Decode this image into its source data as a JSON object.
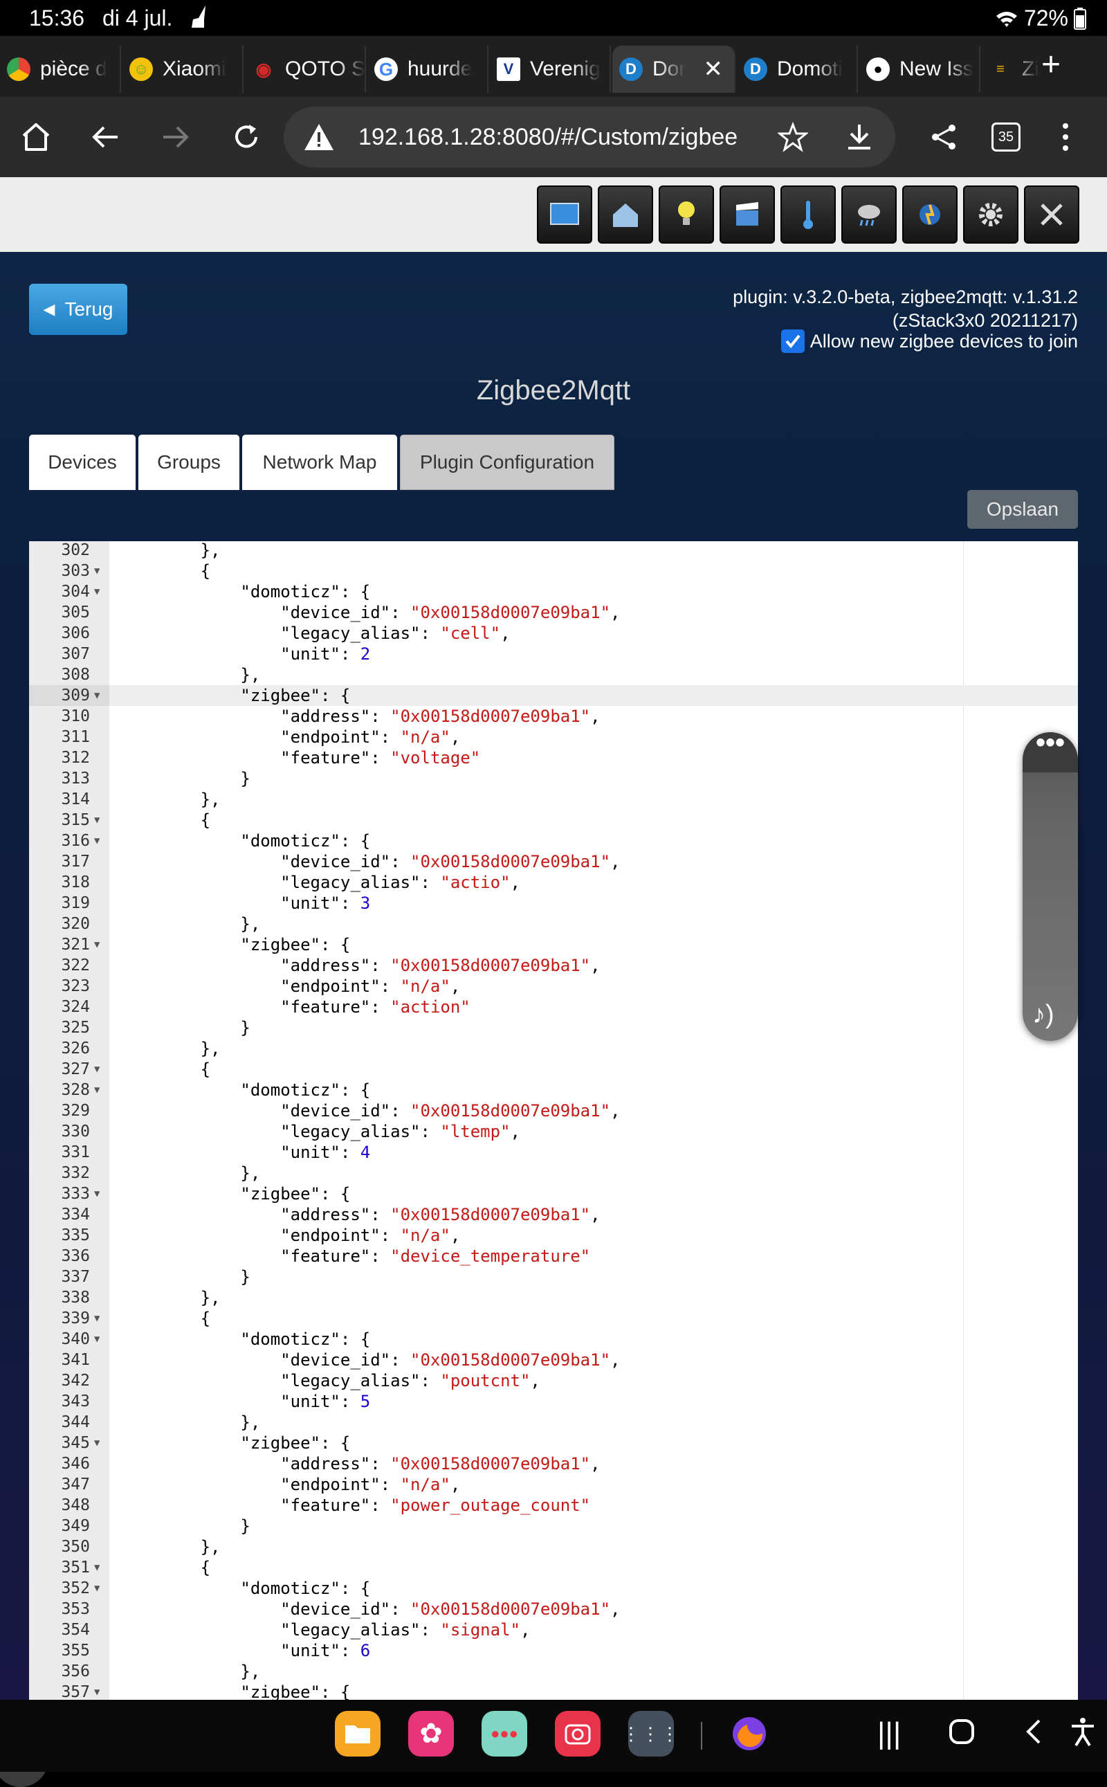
{
  "status": {
    "time": "15:36",
    "date": "di 4 jul.",
    "battery": "72%"
  },
  "browser_tabs": [
    {
      "label": "pièce d",
      "icon": "chrome-multicolor-icon",
      "color": "#ffffff"
    },
    {
      "label": "Xiaomi",
      "icon": "face-emoji-icon",
      "color": "#f4c20d"
    },
    {
      "label": "QOTO S",
      "icon": "wifi-red-icon",
      "color": "#d62829"
    },
    {
      "label": "huurde",
      "icon": "google-icon",
      "color": "#ffffff"
    },
    {
      "label": "Verenig",
      "icon": "v-logo-icon",
      "color": "#ffffff"
    },
    {
      "label": "Dor",
      "icon": "domoticz-icon",
      "color": "#1f7ec9"
    },
    {
      "label": "Domoti",
      "icon": "domoticz-icon",
      "color": "#1f7ec9"
    },
    {
      "label": "New Iss",
      "icon": "github-icon",
      "color": "#ffffff"
    },
    {
      "label": "Zi",
      "icon": "zigbee-icon",
      "color": "#f4b400"
    }
  ],
  "toolbar": {
    "url": "192.168.1.28:8080/#/Custom/zigbee",
    "tab_count": "35"
  },
  "app": {
    "back_label": "Terug",
    "plugin_info": "plugin: v.3.2.0-beta, zigbee2mqtt: v.1.31.2 (zStack3x0 20211217)",
    "allow_join_label": "Allow new zigbee devices to join",
    "allow_join_checked": true,
    "title": "Zigbee2Mqtt",
    "tabs": [
      "Devices",
      "Groups",
      "Network Map",
      "Plugin Configuration"
    ],
    "active_tab": "Plugin Configuration",
    "save_label": "Opslaan"
  },
  "editor": {
    "active_line": 309,
    "lines": [
      {
        "n": 302,
        "code": "        },"
      },
      {
        "n": 303,
        "fold": true,
        "code": "        {"
      },
      {
        "n": 304,
        "fold": true,
        "code": "            \"domoticz\": {"
      },
      {
        "n": 305,
        "code": "                \"device_id\": \"0x00158d0007e09ba1\","
      },
      {
        "n": 306,
        "code": "                \"legacy_alias\": \"cell\","
      },
      {
        "n": 307,
        "code": "                \"unit\": 2"
      },
      {
        "n": 308,
        "code": "            },"
      },
      {
        "n": 309,
        "fold": true,
        "code": "            \"zigbee\": {"
      },
      {
        "n": 310,
        "code": "                \"address\": \"0x00158d0007e09ba1\","
      },
      {
        "n": 311,
        "code": "                \"endpoint\": \"n/a\","
      },
      {
        "n": 312,
        "code": "                \"feature\": \"voltage\""
      },
      {
        "n": 313,
        "code": "            }"
      },
      {
        "n": 314,
        "code": "        },"
      },
      {
        "n": 315,
        "fold": true,
        "code": "        {"
      },
      {
        "n": 316,
        "fold": true,
        "code": "            \"domoticz\": {"
      },
      {
        "n": 317,
        "code": "                \"device_id\": \"0x00158d0007e09ba1\","
      },
      {
        "n": 318,
        "code": "                \"legacy_alias\": \"actio\","
      },
      {
        "n": 319,
        "code": "                \"unit\": 3"
      },
      {
        "n": 320,
        "code": "            },"
      },
      {
        "n": 321,
        "fold": true,
        "code": "            \"zigbee\": {"
      },
      {
        "n": 322,
        "code": "                \"address\": \"0x00158d0007e09ba1\","
      },
      {
        "n": 323,
        "code": "                \"endpoint\": \"n/a\","
      },
      {
        "n": 324,
        "code": "                \"feature\": \"action\""
      },
      {
        "n": 325,
        "code": "            }"
      },
      {
        "n": 326,
        "code": "        },"
      },
      {
        "n": 327,
        "fold": true,
        "code": "        {"
      },
      {
        "n": 328,
        "fold": true,
        "code": "            \"domoticz\": {"
      },
      {
        "n": 329,
        "code": "                \"device_id\": \"0x00158d0007e09ba1\","
      },
      {
        "n": 330,
        "code": "                \"legacy_alias\": \"ltemp\","
      },
      {
        "n": 331,
        "code": "                \"unit\": 4"
      },
      {
        "n": 332,
        "code": "            },"
      },
      {
        "n": 333,
        "fold": true,
        "code": "            \"zigbee\": {"
      },
      {
        "n": 334,
        "code": "                \"address\": \"0x00158d0007e09ba1\","
      },
      {
        "n": 335,
        "code": "                \"endpoint\": \"n/a\","
      },
      {
        "n": 336,
        "code": "                \"feature\": \"device_temperature\""
      },
      {
        "n": 337,
        "code": "            }"
      },
      {
        "n": 338,
        "code": "        },"
      },
      {
        "n": 339,
        "fold": true,
        "code": "        {"
      },
      {
        "n": 340,
        "fold": true,
        "code": "            \"domoticz\": {"
      },
      {
        "n": 341,
        "code": "                \"device_id\": \"0x00158d0007e09ba1\","
      },
      {
        "n": 342,
        "code": "                \"legacy_alias\": \"poutcnt\","
      },
      {
        "n": 343,
        "code": "                \"unit\": 5"
      },
      {
        "n": 344,
        "code": "            },"
      },
      {
        "n": 345,
        "fold": true,
        "code": "            \"zigbee\": {"
      },
      {
        "n": 346,
        "code": "                \"address\": \"0x00158d0007e09ba1\","
      },
      {
        "n": 347,
        "code": "                \"endpoint\": \"n/a\","
      },
      {
        "n": 348,
        "code": "                \"feature\": \"power_outage_count\""
      },
      {
        "n": 349,
        "code": "            }"
      },
      {
        "n": 350,
        "code": "        },"
      },
      {
        "n": 351,
        "fold": true,
        "code": "        {"
      },
      {
        "n": 352,
        "fold": true,
        "code": "            \"domoticz\": {"
      },
      {
        "n": 353,
        "code": "                \"device_id\": \"0x00158d0007e09ba1\","
      },
      {
        "n": 354,
        "code": "                \"legacy_alias\": \"signal\","
      },
      {
        "n": 355,
        "code": "                \"unit\": 6"
      },
      {
        "n": 356,
        "code": "            },"
      },
      {
        "n": 357,
        "fold": true,
        "code": "            \"zigbee\": {"
      }
    ]
  }
}
